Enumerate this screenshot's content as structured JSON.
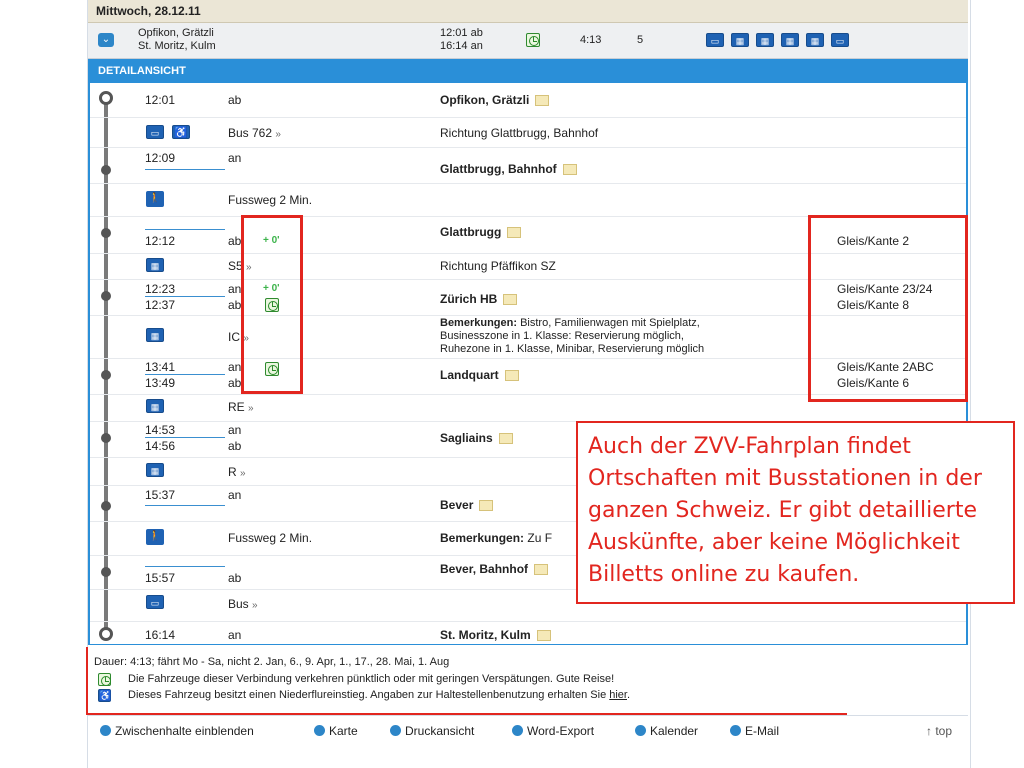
{
  "date_bar": {
    "date": "Mittwoch, 28.12.11"
  },
  "summary": {
    "from": "Opfikon, Grätzli",
    "to": "St. Moritz, Kulm",
    "dep": "12:01 ab",
    "arr": "16:14 an",
    "duration": "4:13",
    "changes": "5"
  },
  "detail_header": {
    "title": "DETAILANSICHT"
  },
  "rows": {
    "r1": {
      "time": "12:01",
      "type": "ab",
      "place": "Opfikon, Grätzli"
    },
    "r2": {
      "line": "Bus 762",
      "direction": "Richtung Glattbrugg, Bahnhof"
    },
    "r3": {
      "time": "12:09",
      "type": "an",
      "place": "Glattbrugg, Bahnhof"
    },
    "r4": {
      "line": "Fussweg 2 Min."
    },
    "r5": {
      "time": "12:12",
      "type": "ab",
      "delay": "+ 0'",
      "place": "Glattbrugg",
      "platform": "Gleis/Kante 2"
    },
    "r6": {
      "line": "S5",
      "direction": "Richtung Pfäffikon SZ"
    },
    "r7": {
      "time_a": "12:23",
      "type_a": "an",
      "delay": "+ 0'",
      "time_b": "12:37",
      "type_b": "ab",
      "place": "Zürich HB",
      "platform_a": "Gleis/Kante 23/24",
      "platform_b": "Gleis/Kante 8"
    },
    "r8": {
      "line": "IC",
      "remarks_label": "Bemerkungen:",
      "remarks_1": "Bistro, Familienwagen mit Spielplatz,",
      "remarks_2": "Businesszone in 1. Klasse: Reservierung möglich,",
      "remarks_3": "Ruhezone in 1. Klasse, Minibar, Reservierung möglich"
    },
    "r9": {
      "time_a": "13:41",
      "type_a": "an",
      "time_b": "13:49",
      "type_b": "ab",
      "place": "Landquart",
      "platform_a": "Gleis/Kante 2ABC",
      "platform_b": "Gleis/Kante 6"
    },
    "r10": {
      "line": "RE"
    },
    "r11": {
      "time_a": "14:53",
      "type_a": "an",
      "time_b": "14:56",
      "type_b": "ab",
      "place": "Sagliains"
    },
    "r12": {
      "line": "R"
    },
    "r13": {
      "time": "15:37",
      "type": "an",
      "place": "Bever"
    },
    "r14": {
      "line": "Fussweg 2 Min.",
      "remarks_label": "Bemerkungen:",
      "remarks_tail": "Zu F"
    },
    "r15": {
      "time": "15:57",
      "type": "ab",
      "place": "Bever, Bahnhof"
    },
    "r16": {
      "line": "Bus"
    },
    "r17": {
      "time": "16:14",
      "type": "an",
      "place": "St. Moritz, Kulm"
    }
  },
  "callout": {
    "text": "Auch der ZVV-Fahrplan findet Ortschaften mit Busstationen in der ganzen Schweiz. Er gibt detaillierte Auskünfte, aber keine Möglichkeit Billetts online zu kaufen."
  },
  "notes": {
    "duration": "Dauer: 4:13; fährt Mo - Sa, nicht 2. Jan, 6., 9. Apr, 1., 17., 28. Mai, 1. Aug",
    "punctual": "Die Fahrzeuge dieser Verbindung verkehren pünktlich oder mit geringen Verspätungen. Gute Reise!",
    "lowfloor": "Dieses Fahrzeug besitzt einen Niederflureinstieg. Angaben zur Haltestellenbenutzung erhalten Sie",
    "hier": "hier",
    "period": "."
  },
  "bottom_links": {
    "stops": "Zwischenhalte einblenden",
    "map": "Karte",
    "print": "Druckansicht",
    "word": "Word-Export",
    "calendar": "Kalender",
    "email": "E-Mail",
    "top": "↑ top"
  },
  "icons": {
    "bus": "bus-icon",
    "train": "train-icon",
    "walk": "walk-icon",
    "wheelchair": "wheelchair-icon",
    "clock": "clock-icon",
    "map": "map-icon",
    "expand": "expand-icon"
  },
  "colors": {
    "accent": "#2a8fd8",
    "highlight": "#e2261f",
    "delay": "#3bb34a"
  }
}
